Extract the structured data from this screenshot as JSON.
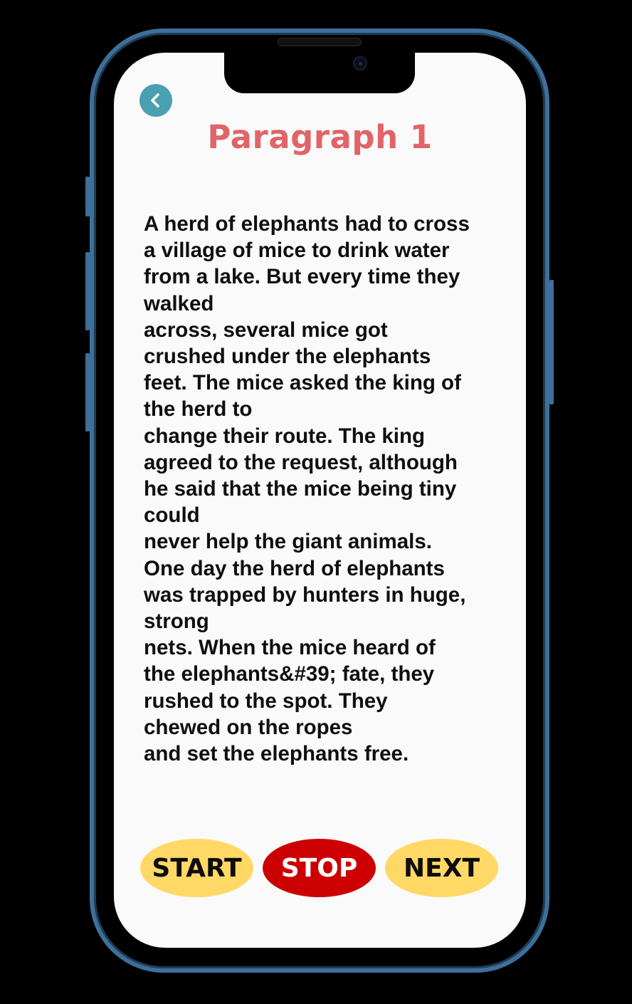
{
  "screen": {
    "title": "Paragraph 1",
    "back_icon": "chevron-left-icon",
    "paragraph_lines": [
      "A herd of elephants had to cross",
      "a village of mice to drink water",
      "from a lake. But every time they",
      "walked",
      "across, several mice got",
      "crushed under the elephants",
      "feet. The mice asked the king of",
      "the herd to",
      "change their route. The king",
      "agreed to the request, although",
      "he said that the mice being tiny",
      "could",
      "never help the giant animals.",
      "One day the herd of elephants",
      "was trapped by hunters in huge,",
      "strong",
      "nets. When the mice heard of",
      "the elephants&#39; fate, they",
      "rushed to the spot. They",
      "chewed on the ropes",
      "and set the elephants free."
    ]
  },
  "controls": {
    "start_label": "START",
    "stop_label": "STOP",
    "next_label": "NEXT"
  },
  "colors": {
    "title": "#e06468",
    "back_button": "#4a9fb0",
    "start_next_button": "#ffd866",
    "stop_button": "#cc0000",
    "phone_frame": "#3d6f9a"
  }
}
